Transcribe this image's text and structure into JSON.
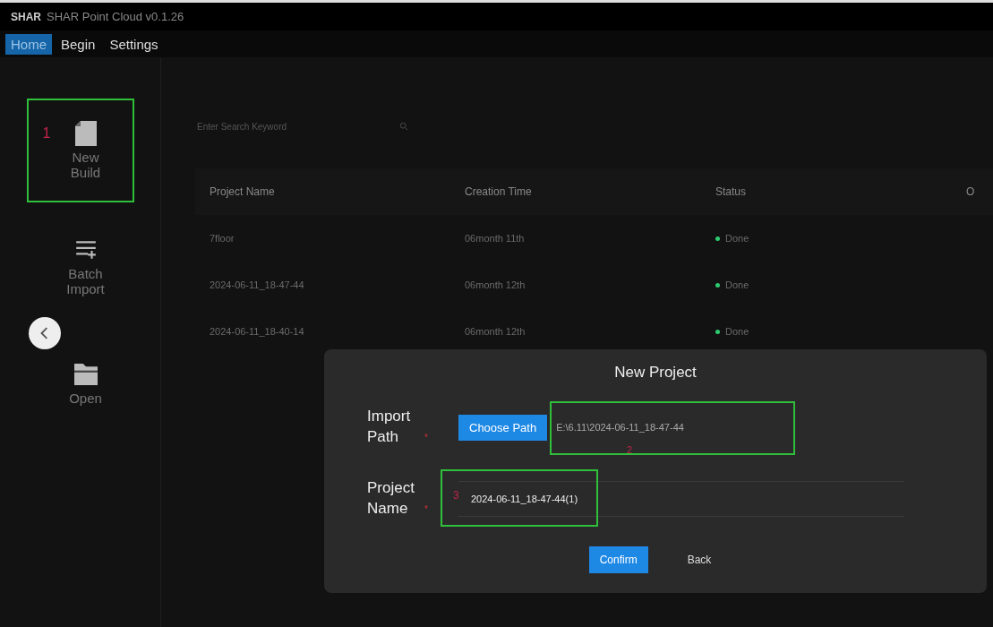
{
  "window": {
    "logo": "SHAR",
    "title": "SHAR Point Cloud v0.1.26"
  },
  "menu": [
    {
      "label": "Home",
      "selected": true
    },
    {
      "label": "Begin",
      "selected": false
    },
    {
      "label": "Settings",
      "selected": false
    }
  ],
  "sidebar": {
    "items": [
      {
        "kind": "file",
        "label": "New Build",
        "annotation": "1"
      },
      {
        "kind": "list",
        "label": "Batch Import"
      },
      {
        "kind": "folder",
        "label": "Open"
      }
    ]
  },
  "search": {
    "placeholder": "Enter Search Keyword"
  },
  "table": {
    "columns": [
      "Project Name",
      "Creation Time",
      "Status",
      "O"
    ],
    "rows": [
      {
        "name": "7floor",
        "time": "06month 11th",
        "status": "Done",
        "color": "#2ecc71"
      },
      {
        "name": "2024-06-11_18-47-44",
        "time": "06month 12th",
        "status": "Done",
        "color": "#2ecc71"
      },
      {
        "name": "2024-06-11_18-40-14",
        "time": "06month 12th",
        "status": "Done",
        "color": "#2ecc71"
      }
    ]
  },
  "dialog": {
    "title": "New Project",
    "import_path": {
      "label": "Import Path",
      "required_mark": "*",
      "button": "Choose Path",
      "value": "E:\\6.11\\2024-06-11_18-47-44",
      "annotation": "2"
    },
    "project_name": {
      "label": "Project Name",
      "required_mark": "*",
      "value": "2024-06-11_18-47-44(1)",
      "annotation": "3"
    },
    "buttons": [
      "Confirm",
      "Back"
    ]
  }
}
